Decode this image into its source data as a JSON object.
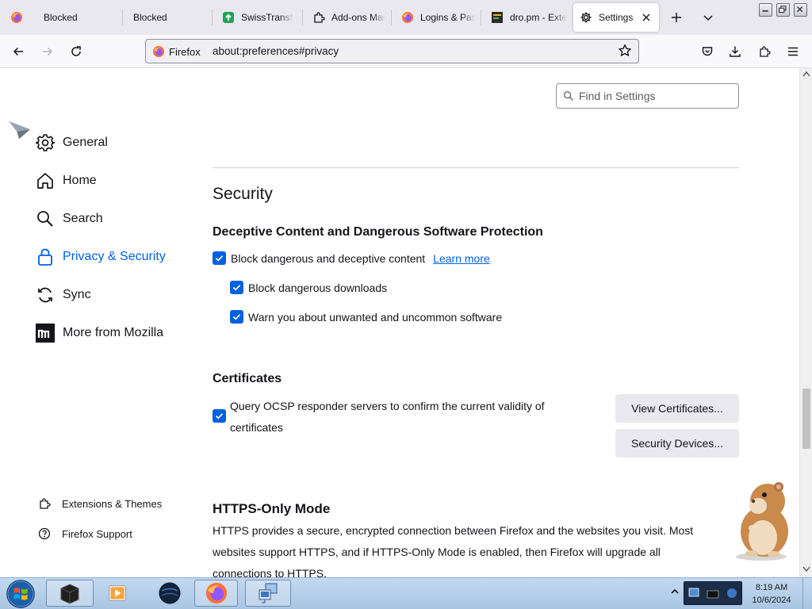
{
  "tabs": [
    {
      "title": "Blocked",
      "icon": "firefox-icon"
    },
    {
      "title": "Blocked",
      "icon": "none"
    },
    {
      "title": "SwissTransfer",
      "icon": "swisstransfer-icon"
    },
    {
      "title": "Add-ons Manager",
      "icon": "puzzle-icon"
    },
    {
      "title": "Logins & Passwords",
      "icon": "firefox-icon"
    },
    {
      "title": "dro.pm - Extension",
      "icon": "dropm-icon"
    },
    {
      "title": "Settings",
      "icon": "gear-icon",
      "active": true
    }
  ],
  "urlbar": {
    "identity_label": "Firefox",
    "url": "about:preferences#privacy"
  },
  "sidebar": {
    "categories": [
      {
        "label": "General",
        "icon": "gear-icon"
      },
      {
        "label": "Home",
        "icon": "home-icon"
      },
      {
        "label": "Search",
        "icon": "search-icon"
      },
      {
        "label": "Privacy & Security",
        "icon": "lock-icon",
        "selected": true
      },
      {
        "label": "Sync",
        "icon": "sync-icon"
      },
      {
        "label": "More from Mozilla",
        "icon": "mozilla-icon"
      }
    ],
    "footer_links": [
      {
        "label": "Extensions & Themes",
        "icon": "puzzle-icon"
      },
      {
        "label": "Firefox Support",
        "icon": "help-icon"
      }
    ]
  },
  "find": {
    "placeholder": "Find in Settings"
  },
  "main": {
    "section_title": "Security",
    "deceptive": {
      "heading": "Deceptive Content and Dangerous Software Protection",
      "block_dangerous_content": "Block dangerous and deceptive content",
      "learn_more": "Learn more",
      "block_downloads": "Block dangerous downloads",
      "warn_unwanted": "Warn you about unwanted and uncommon software"
    },
    "certificates": {
      "heading": "Certificates",
      "ocsp_line1": "Query OCSP responder servers to confirm the current validity of",
      "ocsp_line2": "certificates",
      "view_button": "View Certificates...",
      "devices_button": "Security Devices..."
    },
    "https_only": {
      "heading": "HTTPS-Only Mode",
      "line1": "HTTPS provides a secure, encrypted connection between Firefox and the websites you visit. Most",
      "line2": "websites support HTTPS, and if HTTPS-Only Mode is enabled, then Firefox will upgrade all",
      "line3": "connections to HTTPS."
    }
  },
  "taskbar": {
    "time": "8:19 AM",
    "date": "10/6/2024"
  },
  "colors": {
    "accent": "#0061e0",
    "tabstrip": "#e9e8ef",
    "button_bg": "#e9e8ee"
  }
}
